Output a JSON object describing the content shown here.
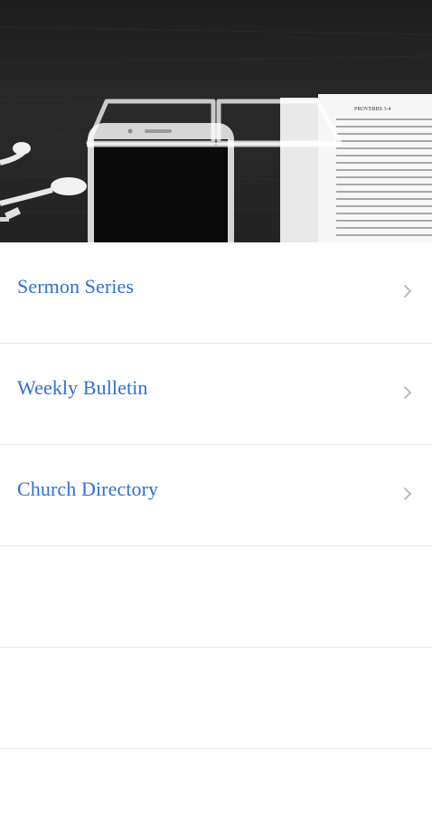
{
  "hero": {
    "image": "desk-with-phone-earbuds-open-bible",
    "icon": "open-book-icon",
    "bible_heading": "PROVERBS 3-4"
  },
  "menu": {
    "items": [
      {
        "label": "Sermon Series",
        "icon": "chevron-right-icon"
      },
      {
        "label": "Weekly Bulletin",
        "icon": "chevron-right-icon"
      },
      {
        "label": "Church Directory",
        "icon": "chevron-right-icon"
      }
    ],
    "empty_rows": 3
  },
  "colors": {
    "accent": "#2f6fd6",
    "divider": "#e6e6e6",
    "chevron": "#b5b5b5",
    "background": "#ffffff"
  }
}
